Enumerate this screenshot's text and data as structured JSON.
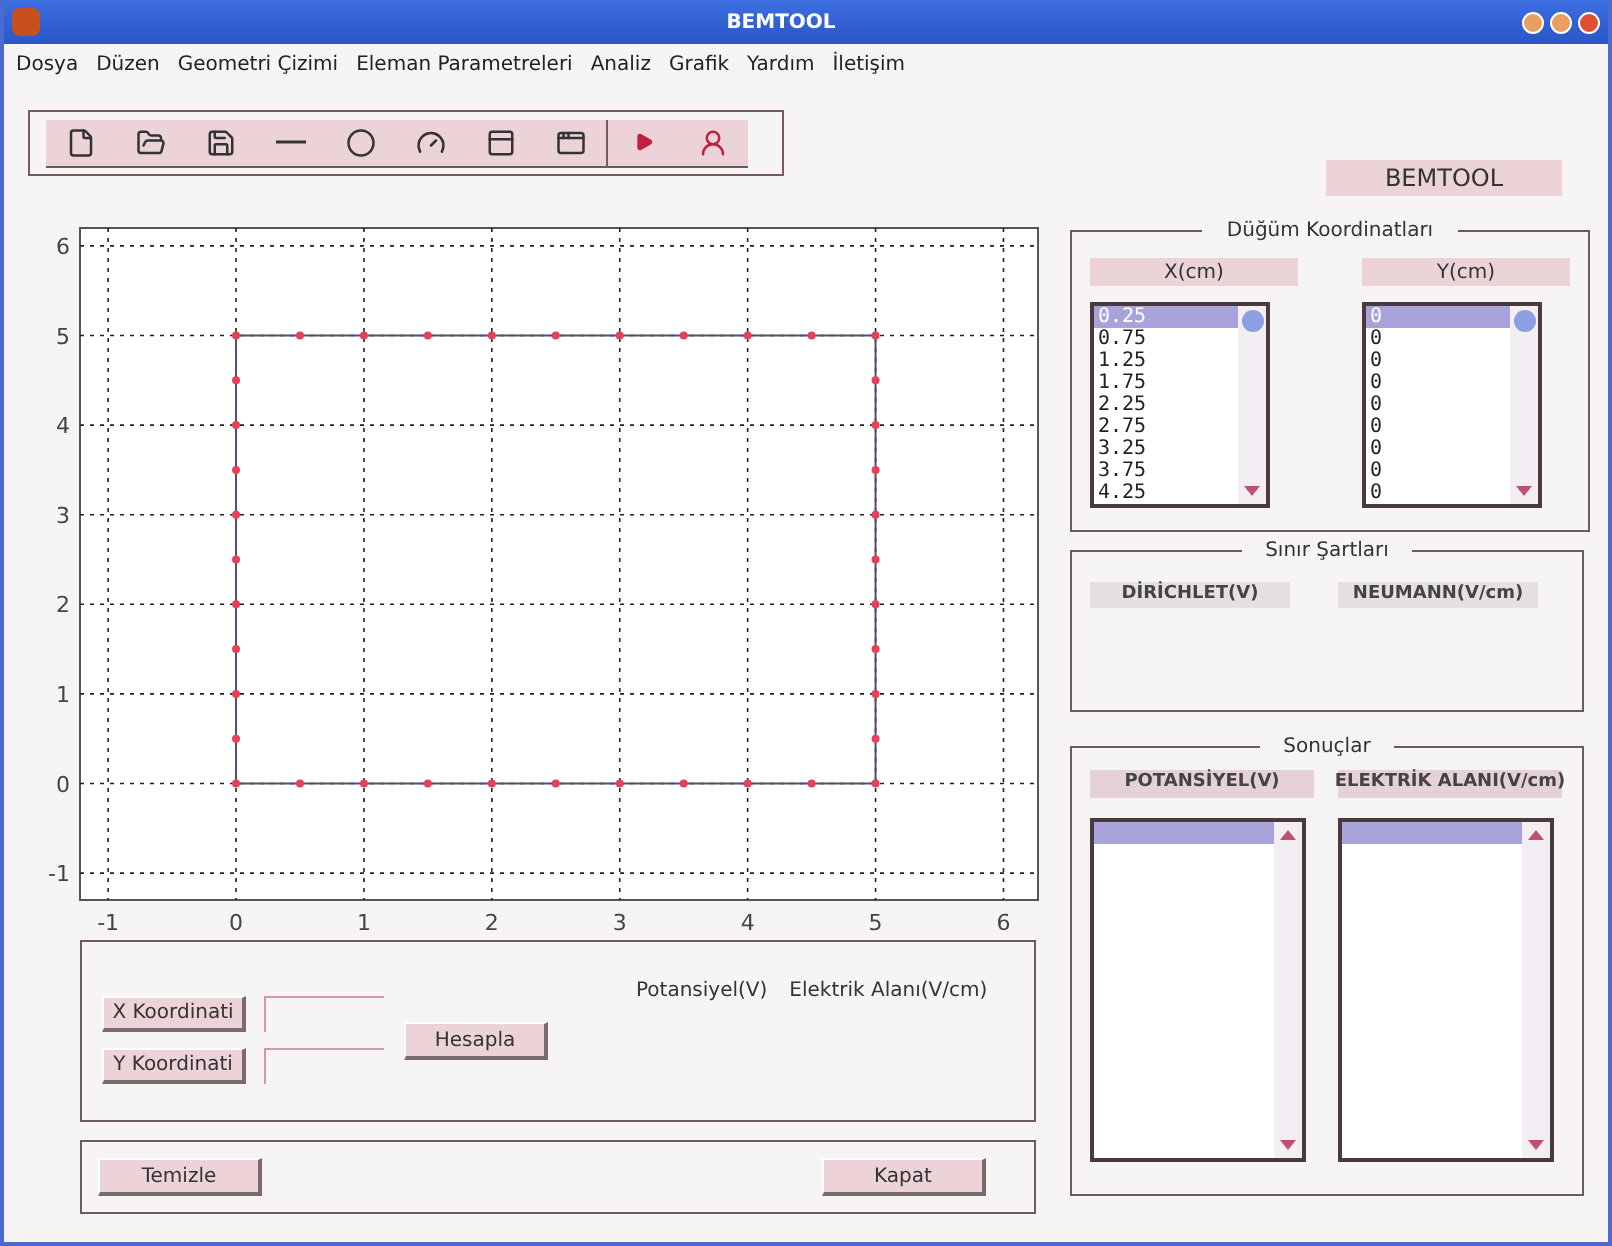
{
  "window": {
    "title": "BEMTOOL"
  },
  "menu": [
    "Dosya",
    "Düzen",
    "Geometri Çizimi",
    "Eleman Parametreleri",
    "Analiz",
    "Grafik",
    "Yardım",
    "İletişim"
  ],
  "app_label": "BEMTOOL",
  "plot": {
    "chart_data": {
      "type": "scatter",
      "grid": true,
      "xlim": [
        -1.22,
        6.27
      ],
      "ylim": [
        -1.3,
        6.2
      ],
      "xticks": [
        -1,
        0,
        1,
        2,
        3,
        4,
        5,
        6
      ],
      "yticks": [
        -1,
        0,
        1,
        2,
        3,
        4,
        5,
        6
      ],
      "x": [
        0,
        0.5,
        1,
        1.5,
        2,
        2.5,
        3,
        3.5,
        4,
        4.5,
        5,
        5,
        5,
        5,
        5,
        5,
        5,
        5,
        5,
        5,
        5,
        4.5,
        4,
        3.5,
        3,
        2.5,
        2,
        1.5,
        1,
        0.5,
        0,
        0,
        0,
        0,
        0,
        0,
        0,
        0,
        0,
        0
      ],
      "series": [
        {
          "color": "#e8405a",
          "values": [
            0,
            0,
            0,
            0,
            0,
            0,
            0,
            0,
            0,
            0,
            0,
            0.5,
            1,
            1.5,
            2,
            2.5,
            3,
            3.5,
            4,
            4.5,
            5,
            5,
            5,
            5,
            5,
            5,
            5,
            5,
            5,
            5,
            5,
            4.5,
            4,
            3.5,
            3,
            2.5,
            2,
            1.5,
            1,
            0.5
          ]
        }
      ]
    }
  },
  "probe_panel": {
    "x_button": "X Koordinati",
    "y_button": "Y Koordinati",
    "compute_button": "Hesapla",
    "potential_label": "Potansiyel(V)",
    "field_label": "Elektrik Alanı(V/cm)"
  },
  "actions": {
    "clear_button": "Temizle",
    "close_button": "Kapat"
  },
  "node_panel": {
    "title": "Düğüm Koordinatları",
    "columns": [
      {
        "header": "X(cm)",
        "items": [
          {
            "text": "0.25",
            "selected": true
          },
          {
            "text": "0.75",
            "selected": false
          },
          {
            "text": "1.25",
            "selected": false
          },
          {
            "text": "1.75",
            "selected": false
          },
          {
            "text": "2.25",
            "selected": false
          },
          {
            "text": "2.75",
            "selected": false
          },
          {
            "text": "3.25",
            "selected": false
          },
          {
            "text": "3.75",
            "selected": false
          },
          {
            "text": "4.25",
            "selected": false
          }
        ]
      },
      {
        "header": "Y(cm)",
        "items": [
          {
            "text": "0",
            "selected": true
          },
          {
            "text": "0",
            "selected": false
          },
          {
            "text": "0",
            "selected": false
          },
          {
            "text": "0",
            "selected": false
          },
          {
            "text": "0",
            "selected": false
          },
          {
            "text": "0",
            "selected": false
          },
          {
            "text": "0",
            "selected": false
          },
          {
            "text": "0",
            "selected": false
          },
          {
            "text": "0",
            "selected": false
          }
        ]
      }
    ]
  },
  "boundary_panel": {
    "title": "Sınır Şartları",
    "headers": [
      "DİRİCHLET(V)",
      "NEUMANN(V/cm)"
    ]
  },
  "results_panel": {
    "title": "Sonuçlar",
    "columns": [
      {
        "header": "POTANSİYEL(V)",
        "items": [
          {
            "selected": true
          }
        ]
      },
      {
        "header": "ELEKTRİK ALANI(V/cm)",
        "items": [
          {
            "selected": true
          }
        ]
      }
    ]
  }
}
